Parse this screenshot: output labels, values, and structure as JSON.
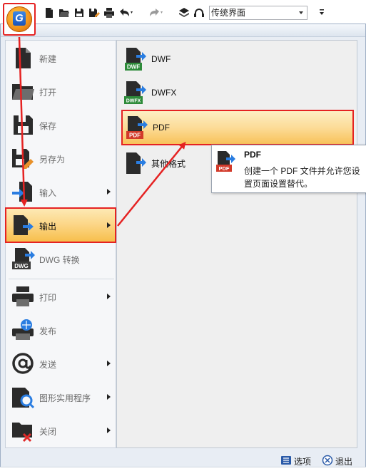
{
  "toolbar": {
    "workspace_value": "传统界面",
    "icons": [
      "new-icon",
      "open-icon",
      "save-icon",
      "save-as-icon",
      "print-icon",
      "undo-icon",
      "redo-icon",
      "layers-icon",
      "headset-icon"
    ]
  },
  "menu": {
    "left_items": [
      {
        "key": "new",
        "label": "新建",
        "submenu": false
      },
      {
        "key": "open",
        "label": "打开",
        "submenu": false
      },
      {
        "key": "save",
        "label": "保存",
        "submenu": false
      },
      {
        "key": "save_as",
        "label": "另存为",
        "submenu": false
      },
      {
        "key": "import",
        "label": "输入",
        "submenu": true
      },
      {
        "key": "export",
        "label": "输出",
        "submenu": true,
        "active": true
      },
      {
        "key": "dwg_convert",
        "label": "DWG 转换",
        "submenu": false
      },
      {
        "key": "print",
        "label": "打印",
        "submenu": true
      },
      {
        "key": "publish",
        "label": "发布",
        "submenu": false
      },
      {
        "key": "send",
        "label": "发送",
        "submenu": true
      },
      {
        "key": "utilities",
        "label": "图形实用程序",
        "submenu": true
      },
      {
        "key": "close",
        "label": "关闭",
        "submenu": true
      }
    ],
    "right_items": [
      {
        "key": "dwf",
        "label": "DWF",
        "badge": "DWF",
        "badge_color": "#2e8b3a"
      },
      {
        "key": "dwfx",
        "label": "DWFX",
        "badge": "DWFX",
        "badge_color": "#2e8b3a"
      },
      {
        "key": "pdf",
        "label": "PDF",
        "badge": "PDF",
        "badge_color": "#d23a2a",
        "active": true
      },
      {
        "key": "other",
        "label": "其他格式"
      }
    ],
    "tooltip": {
      "title": "PDF",
      "description": "创建一个 PDF 文件并允许您设置页面设置替代。",
      "badge": "PDF"
    },
    "bottom": {
      "options_label": "选项",
      "exit_label": "退出"
    }
  },
  "colors": {
    "highlight_border": "#e52222",
    "hover_gradient_top": "#fde9b4",
    "hover_gradient_bottom": "#f7bf4c",
    "arrow_blue": "#2a7de1"
  }
}
